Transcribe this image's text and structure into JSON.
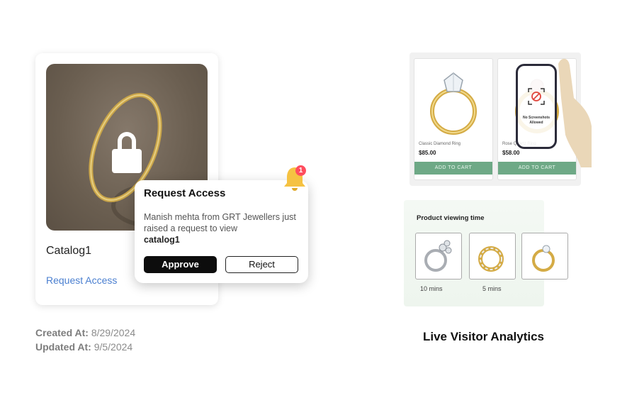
{
  "catalog_card": {
    "title": "Catalog1",
    "request_link": "Request Access",
    "created_label": "Created At:",
    "created_value": "8/29/2024",
    "updated_label": "Updated At:",
    "updated_value": "9/5/2024"
  },
  "popup": {
    "title": "Request Access",
    "message": "Manish mehta from GRT Jewellers just raised a request to view",
    "target": "catalog1",
    "approve_label": "Approve",
    "reject_label": "Reject",
    "notification_count": "1"
  },
  "shop": {
    "products": [
      {
        "name": "Classic Diamond Ring",
        "price": "$85.00",
        "button": "ADD TO CART"
      },
      {
        "name": "Rose Quartz Ring",
        "price": "$58.00",
        "button": "ADD TO CART"
      }
    ],
    "phone_message": "No Screenshots Allowed"
  },
  "viewing_time": {
    "title": "Product viewing time",
    "items": [
      {
        "label": "10 mins"
      },
      {
        "label": "5 mins"
      }
    ]
  },
  "analytics_title": "Live Visitor Analytics",
  "colors": {
    "link": "#4a7fd0",
    "cart_button": "#6ea986",
    "badge": "#ff4d5e",
    "bell": "#f5c242"
  }
}
